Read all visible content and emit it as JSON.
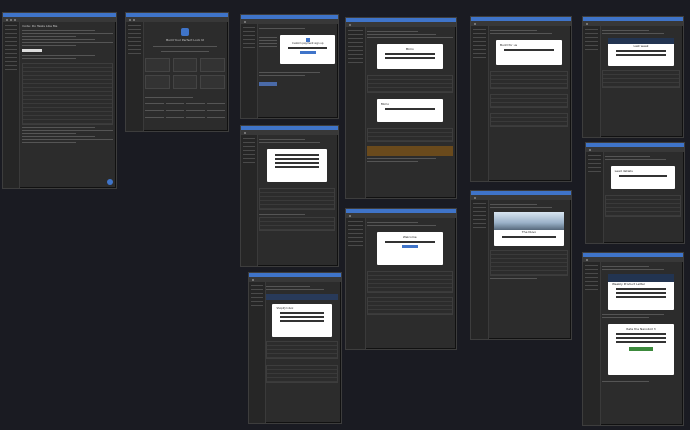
{
  "frames": [
    {
      "id": "f1",
      "title": "Code: Do Tasks Like Me"
    },
    {
      "id": "f2",
      "title": "Build Your Perfect Lock UI"
    },
    {
      "id": "f3",
      "title": "Custom payment sign up"
    },
    {
      "id": "f4",
      "title": "Mimo"
    },
    {
      "id": "f5",
      "title": "Build for us"
    },
    {
      "id": "f6",
      "title": "Last week"
    },
    {
      "id": "f7",
      "title": "Mimo"
    },
    {
      "id": "f8",
      "title": "UX Auditoring"
    },
    {
      "id": "f9",
      "title": "Lead details"
    },
    {
      "id": "f10",
      "title": "Shopify Inbox"
    },
    {
      "id": "f11",
      "title": "Mimo"
    },
    {
      "id": "f12",
      "title": "Weekly Product Letter"
    },
    {
      "id": "f13",
      "title": "Welcome"
    },
    {
      "id": "f14",
      "title": "The Nuvo"
    },
    {
      "id": "f15",
      "title": "Rate the Nanobot 3"
    }
  ],
  "colors": {
    "accent": "#3f74c9",
    "background": "#1a1b22",
    "panel": "#2c2c2c"
  }
}
